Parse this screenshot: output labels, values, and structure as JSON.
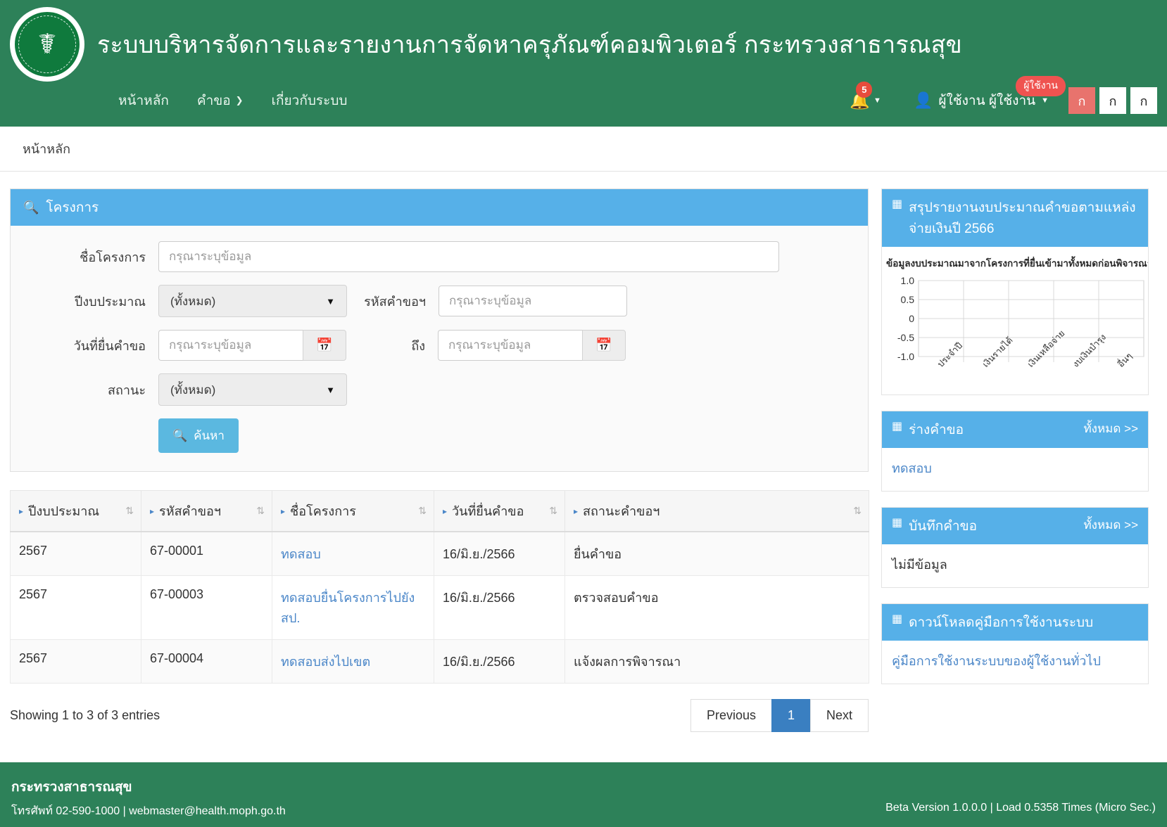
{
  "header": {
    "logo_alt": "ministry-of-public-health-seal",
    "title": "ระบบบริหารจัดการและรายงานการจัดหาครุภัณฑ์คอมพิวเตอร์ กระทรวงสาธารณสุข",
    "nav": [
      {
        "label": "หน้าหลัก",
        "has_caret": false
      },
      {
        "label": "คำขอ",
        "has_caret": true
      },
      {
        "label": "เกี่ยวกับระบบ",
        "has_caret": false
      }
    ],
    "notification_count": "5",
    "user_name": "ผู้ใช้งาน ผู้ใช้งาน",
    "user_role_badge": "ผู้ใช้งาน",
    "font_buttons": [
      "ก",
      "ก",
      "ก"
    ],
    "font_active_index": 0
  },
  "breadcrumb": {
    "current": "หน้าหลัก"
  },
  "search_panel": {
    "title": "โครงการ",
    "fields": {
      "project_name_label": "ชื่อโครงการ",
      "project_name_placeholder": "กรุณาระบุข้อมูล",
      "budget_year_label": "ปีงบประมาณ",
      "budget_year_value": "(ทั้งหมด)",
      "request_code_label": "รหัสคำขอฯ",
      "request_code_placeholder": "กรุณาระบุข้อมูล",
      "date_from_label": "วันที่ยื่นคำขอ",
      "date_from_placeholder": "กรุณาระบุข้อมูล",
      "date_to_label": "ถึง",
      "date_to_placeholder": "กรุณาระบุข้อมูล",
      "status_label": "สถานะ",
      "status_value": "(ทั้งหมด)"
    },
    "search_button": "ค้นหา"
  },
  "table": {
    "columns": [
      "ปีงบประมาณ",
      "รหัสคำขอฯ",
      "ชื่อโครงการ",
      "วันที่ยื่นคำขอ",
      "สถานะคำขอฯ"
    ],
    "rows": [
      {
        "year": "2567",
        "code": "67-00001",
        "project": "ทดสอบ",
        "date": "16/มิ.ย./2566",
        "status": "ยื่นคำขอ"
      },
      {
        "year": "2567",
        "code": "67-00003",
        "project": "ทดสอบยื่นโครงการไปยังสป.",
        "date": "16/มิ.ย./2566",
        "status": "ตรวจสอบคำขอ"
      },
      {
        "year": "2567",
        "code": "67-00004",
        "project": "ทดสอบส่งไปเขต",
        "date": "16/มิ.ย./2566",
        "status": "แจ้งผลการพิจารณา"
      }
    ],
    "showing_text": "Showing 1 to 3 of 3 entries",
    "pagination": {
      "previous": "Previous",
      "current_page": "1",
      "next": "Next"
    }
  },
  "sidebar": {
    "chart_panel": {
      "title": "สรุปรายงานงบประมาณคำขอตามแหล่งจ่ายเงินปี 2566",
      "note": "ข้อมูลงบประมาณมาจากโครงการที่ยื่นเข้ามาทั้งหมดก่อนพิจารณาคำขอ"
    },
    "draft_panel": {
      "title": "ร่างคำขอ",
      "all_link": "ทั้งหมด >>",
      "items": [
        "ทดสอบ"
      ]
    },
    "record_panel": {
      "title": "บันทึกคำขอ",
      "all_link": "ทั้งหมด >>",
      "empty_text": "ไม่มีข้อมูล"
    },
    "manual_panel": {
      "title": "ดาวน์โหลดคู่มือการใช้งานระบบ",
      "link": "คู่มือการใช้งานระบบของผู้ใช้งานทั่วไป"
    }
  },
  "footer": {
    "org": "กระทรวงสาธารณสุข",
    "contact": "โทรศัพท์ 02-590-1000 | webmaster@health.moph.go.th",
    "version": "Beta Version 1.0.0.0 | Load 0.5358 Times (Micro Sec.)"
  },
  "chart_data": {
    "type": "bar",
    "title": "สรุปรายงานงบประมาณคำขอตามแหล่งจ่ายเงินปี 2566",
    "subtitle": "ข้อมูลงบประมาณมาจากโครงการที่ยื่นเข้ามาทั้งหมดก่อนพิจารณาคำขอ",
    "categories": [
      "ประจำปี",
      "เงินรายได้",
      "เงินเหลือจ่าย",
      "งบเงินบำรุง",
      "อื่นๆ"
    ],
    "values": [
      0,
      0,
      0,
      0,
      0
    ],
    "ytick_labels": [
      "1.0",
      "0.5",
      "0",
      "-0.5",
      "-1.0"
    ],
    "ylim": [
      -1.0,
      1.0
    ],
    "xlabel": "",
    "ylabel": "",
    "grid": true,
    "legend": "none"
  },
  "colors": {
    "brand_green": "#2d8159",
    "panel_blue": "#56b0e8",
    "link_blue": "#4a86c8",
    "badge_red": "#e74c3c",
    "role_badge_red": "#ef5350",
    "pager_active": "#3a7fc1"
  }
}
